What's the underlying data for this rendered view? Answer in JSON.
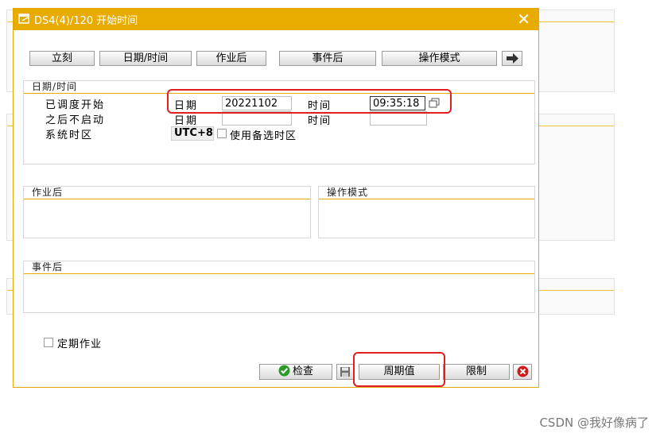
{
  "dialog": {
    "title": "DS4(4)/120 开始时间",
    "close_glyph": "✕"
  },
  "toolbar": {
    "immediate": "立刻",
    "date_time": "日期/时间",
    "after_job": "作业后",
    "after_event": "事件后",
    "operation_mode": "操作模式"
  },
  "datetime_group": {
    "title": "日期/时间",
    "scheduled_start": {
      "label": "已调度开始",
      "date_label": "日期",
      "date_value": "20221102",
      "time_label": "时间",
      "time_value": "09:35:18"
    },
    "no_start_after": {
      "label": "之后不启动",
      "date_label": "日期",
      "date_value": "",
      "time_label": "时间",
      "time_value": ""
    },
    "timezone": {
      "label": "系统时区",
      "value": "UTC+8",
      "alt_checkbox_label": "使用备选时区",
      "alt_checked": false
    }
  },
  "after_job_group": {
    "title": "作业后"
  },
  "operation_mode_group": {
    "title": "操作模式"
  },
  "after_event_group": {
    "title": "事件后"
  },
  "periodic": {
    "label": "定期作业",
    "checked": false
  },
  "buttons": {
    "check": "检查",
    "period_values": "周期值",
    "restrictions": "限制"
  },
  "watermark": "CSDN @我好像病了",
  "colors": {
    "titlebar": "#e8ac00",
    "highlight": "#e02020",
    "check_icon": "#2a9a2a",
    "cancel_icon": "#d11b1b"
  }
}
